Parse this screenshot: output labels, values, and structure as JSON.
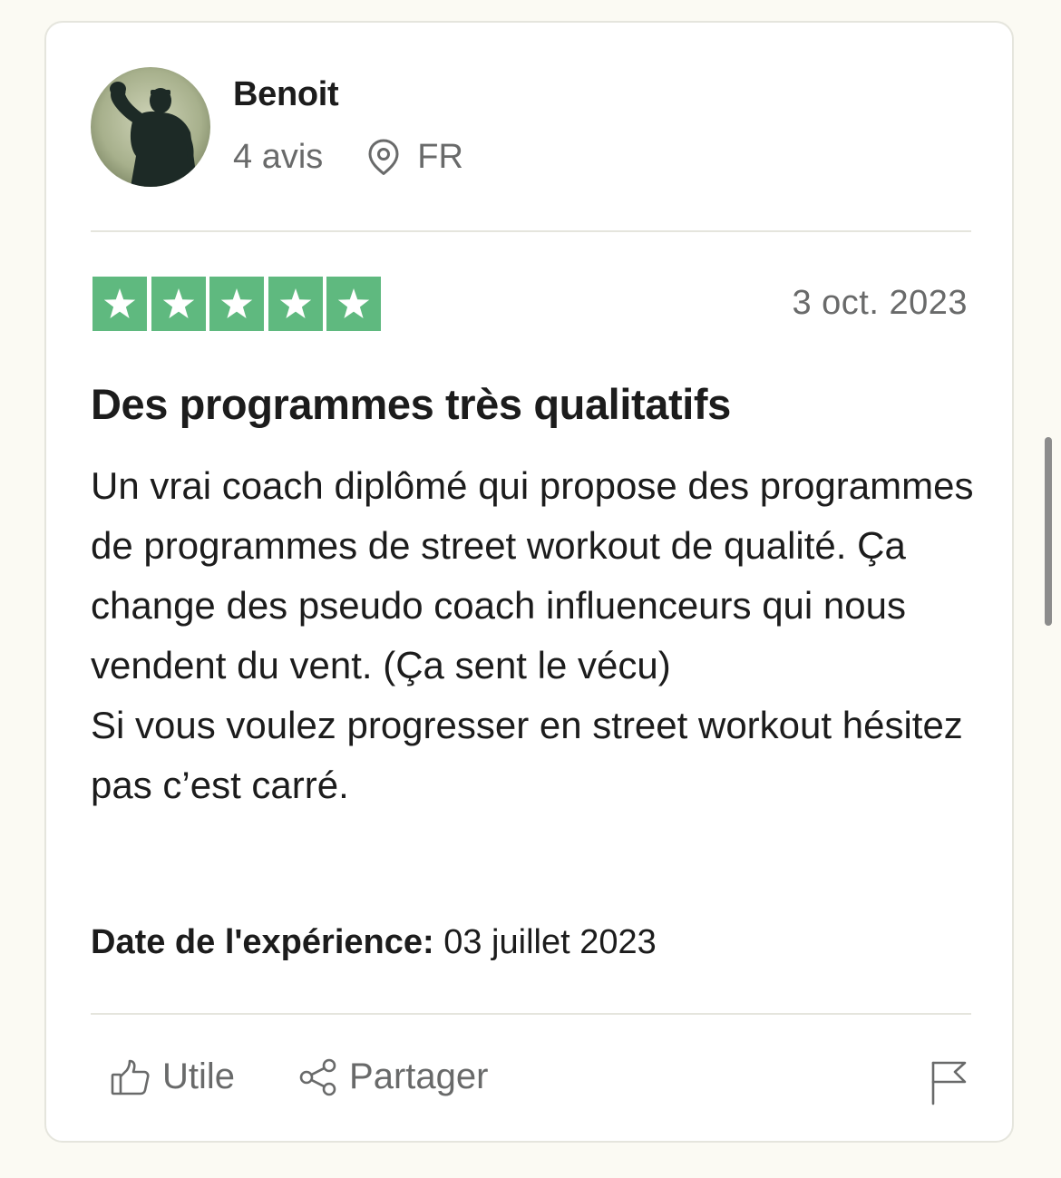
{
  "review": {
    "consumer": {
      "name": "Benoit",
      "review_count": "4 avis",
      "country": "FR",
      "location_icon": "location-pin-icon",
      "avatar": "avatar"
    },
    "rating": {
      "stars": 5,
      "max": 5,
      "star_color": "#5fb97f"
    },
    "date": "3 oct. 2023",
    "title": "Des programmes très qualitatifs",
    "body": "Un vrai coach diplômé qui propose des programmes de programmes de street workout de qualité. Ça change des pseudo coach influenceurs qui nous vendent du vent. (Ça sent le vécu)\nSi vous voulez progresser en street workout hésitez pas c’est carré.",
    "experience": {
      "label": "Date de l'expérience:",
      "value": "03 juillet 2023"
    },
    "actions": {
      "useful_label": "Utile",
      "useful_icon": "thumbs-up-icon",
      "share_label": "Partager",
      "share_icon": "share-icon",
      "report_icon": "flag-icon"
    }
  },
  "colors": {
    "background": "#fbfaf3",
    "card": "#ffffff",
    "border": "#e5e5dd",
    "text": "#1c1c1c",
    "muted": "#696a6a"
  }
}
